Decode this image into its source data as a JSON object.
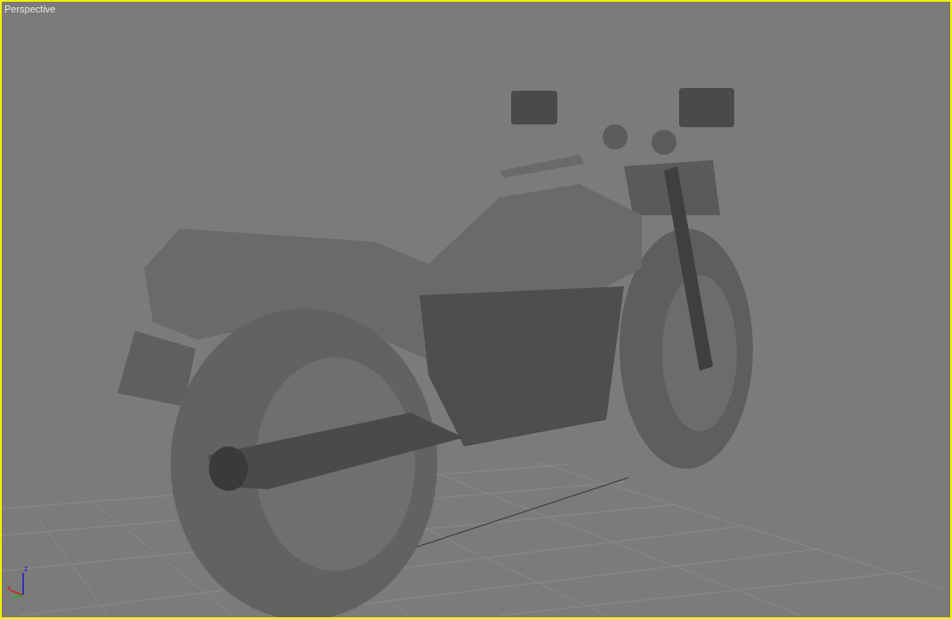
{
  "viewport": {
    "label": "Perspective",
    "active": true
  },
  "axis_gizmo": {
    "labels": [
      "z",
      "x"
    ]
  }
}
